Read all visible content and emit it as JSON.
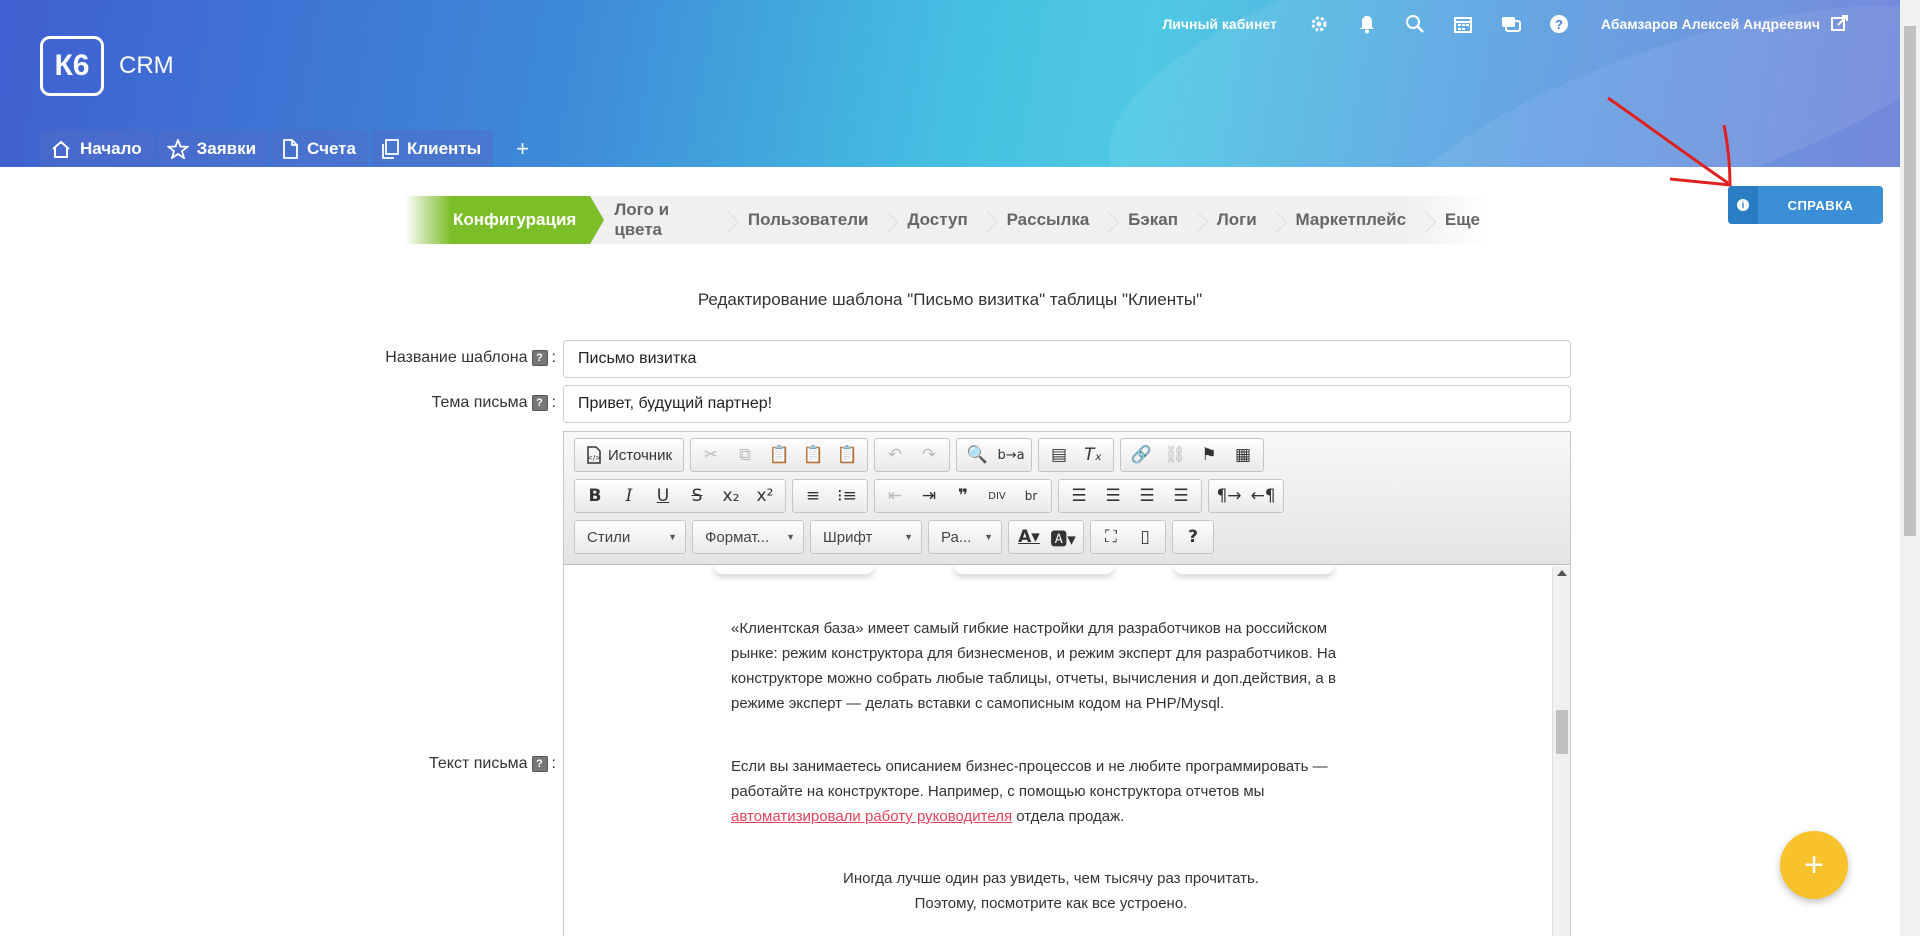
{
  "header": {
    "logo": "К6",
    "app_name": "CRM",
    "account_link": "Личный кабинет",
    "user_name": "Абамзаров Алексей Андреевич",
    "icons": [
      "gear-icon",
      "bell-icon",
      "search-icon",
      "calendar-icon",
      "chat-icon",
      "help-icon"
    ]
  },
  "tabs": [
    {
      "label": "Начало",
      "icon": "home-icon"
    },
    {
      "label": "Заявки",
      "icon": "star-icon"
    },
    {
      "label": "Счета",
      "icon": "document-icon"
    },
    {
      "label": "Клиенты",
      "icon": "copy-icon"
    }
  ],
  "tab_add": "+",
  "help_button": "СПРАВКА",
  "config_nav": [
    "Конфигурация",
    "Лого и цвета",
    "Пользователи",
    "Доступ",
    "Рассылка",
    "Бэкап",
    "Логи",
    "Маркетплейс",
    "Еще"
  ],
  "page_title": "Редактирование шаблона \"Письмо визитка\" таблицы \"Клиенты\"",
  "form": {
    "template_name_label": "Название шаблона",
    "template_name_value": "Письмо визитка",
    "subject_label": "Тема письма",
    "subject_value": "Привет, будущий партнер!",
    "body_label": "Текст письма",
    "colon": ":"
  },
  "editor": {
    "source_label": "Источник",
    "combos": {
      "styles": "Стили",
      "format": "Формат...",
      "font": "Шрифт",
      "size": "Ра..."
    },
    "paragraph1": "«Клиентская база» имеет самый гибкие настройки для разработчиков на российском рынке: режим конструктора для бизнесменов, и режим эксперт для разработчиков. На конструкторе можно собрать любые таблицы, отчеты, вычисления и доп.действия, а в режиме эксперт — делать вставки с самописным кодом на PHP/Mysql.",
    "paragraph2_before": "Если вы занимаетесь описанием бизнес-процессов и не любите программировать — работайте на конструкторе. Например, с помощью конструктора отчетов мы",
    "paragraph2_link": "автоматизировали работу руководителя",
    "paragraph2_after": "отдела продаж.",
    "paragraph3_line1": "Иногда лучше один раз увидеть, чем тысячу раз прочитать.",
    "paragraph3_line2": "Поэтому, посмотрите как все устроено."
  },
  "fab": "+",
  "colors": {
    "accent_green": "#7cbe28",
    "help_blue": "#3a8fd6",
    "fab_yellow": "#f8c22c",
    "link_red": "#e0445a"
  }
}
